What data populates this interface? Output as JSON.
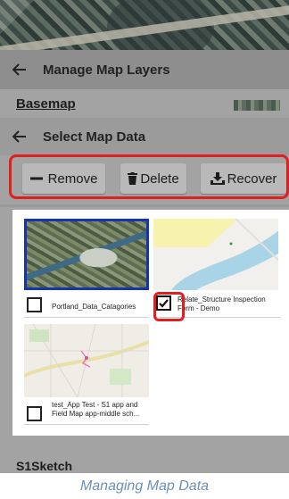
{
  "screen": {
    "topbar_title": "Manage Map Layers",
    "basemap_label": "Basemap",
    "select_title": "Select Map Data",
    "bottom_partial_label": "S1Sketch"
  },
  "actions": {
    "remove_label": "Remove",
    "delete_label": "Delete",
    "recover_label": "Recover"
  },
  "items": [
    {
      "label": "Portland_Data_Catagories",
      "checked": false,
      "selected": true
    },
    {
      "label": "Relate_Structure Inspection Form - Demo",
      "checked": true,
      "selected": false
    },
    {
      "label": "test_App Test - S1 app and Field Map app-middle sch...",
      "checked": false,
      "selected": false
    }
  ],
  "caption": "Managing Map Data",
  "colors": {
    "highlight": "#e0201f",
    "selected_border": "#1433b5",
    "caption": "#6b8fb8"
  },
  "icons": [
    "arrow-left-icon",
    "minus-icon",
    "trash-icon",
    "download-icon",
    "checkmark-icon"
  ]
}
